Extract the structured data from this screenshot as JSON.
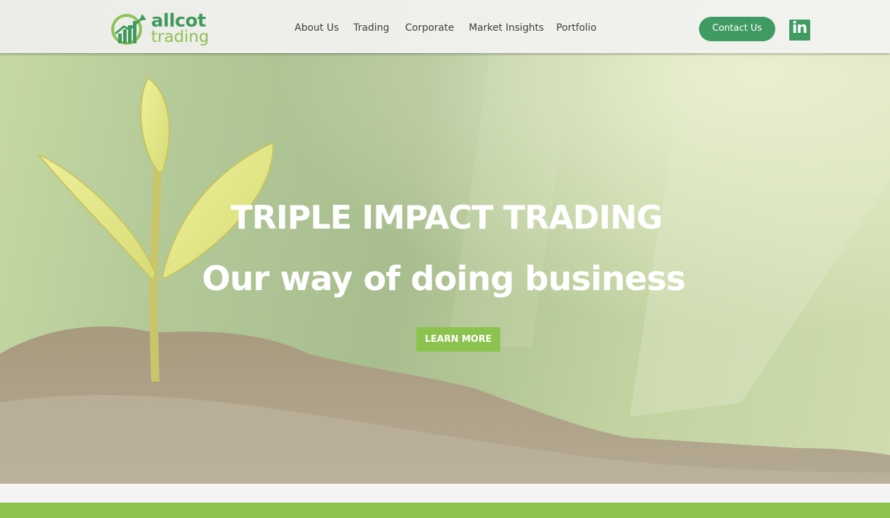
{
  "header": {
    "logo": {
      "word1": "allcot",
      "word2": "trading"
    },
    "nav": [
      {
        "label": "About Us"
      },
      {
        "label": "Trading"
      },
      {
        "label": "Corporate"
      },
      {
        "label": "Market Insights"
      },
      {
        "label": "Portfolio"
      }
    ],
    "contact_label": "Contact Us",
    "social": {
      "linkedin_text": "in"
    }
  },
  "hero": {
    "title": "TRIPLE IMPACT TRADING",
    "subtitle": "Our way of doing business",
    "cta_label": "LEARN MORE"
  },
  "colors": {
    "brand_green": "#3f9b62",
    "accent_lime": "#8cc34e"
  }
}
